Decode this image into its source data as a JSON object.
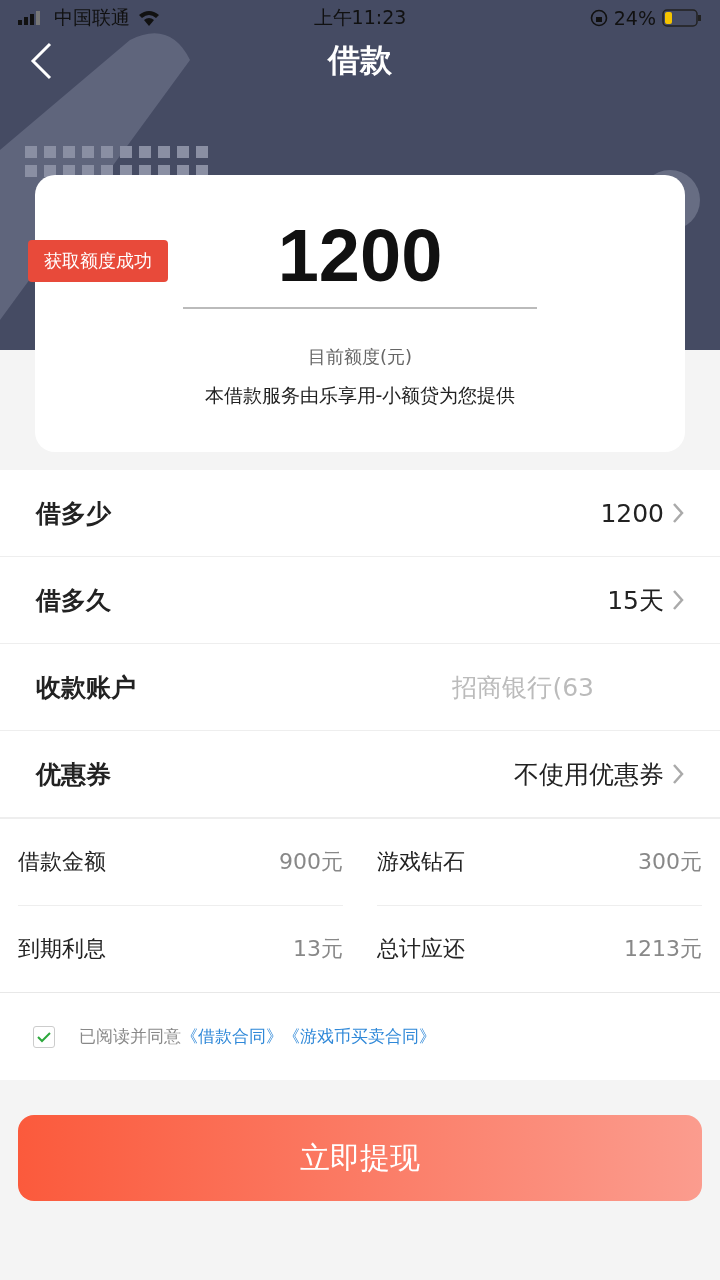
{
  "status_bar": {
    "carrier": "中国联通",
    "time": "上午11:23",
    "battery": "24%"
  },
  "header": {
    "title": "借款"
  },
  "credit_card": {
    "badge": "获取额度成功",
    "amount": "1200",
    "amount_label": "目前额度(元)",
    "provider_note": "本借款服务由乐享用-小额贷为您提供"
  },
  "options": [
    {
      "label": "借多少",
      "value": "1200",
      "kind": "arrow"
    },
    {
      "label": "借多久",
      "value": "15天",
      "kind": "arrow"
    },
    {
      "label": "收款账户",
      "value": "招商银行(63",
      "kind": "faded"
    },
    {
      "label": "优惠券",
      "value": "不使用优惠券",
      "kind": "arrow"
    }
  ],
  "summary": [
    {
      "label": "借款金额",
      "value": "900元"
    },
    {
      "label": "游戏钻石",
      "value": "300元"
    },
    {
      "label": "到期利息",
      "value": "13元"
    },
    {
      "label": "总计应还",
      "value": "1213元"
    }
  ],
  "agreement": {
    "checked": true,
    "text": "已阅读并同意",
    "links": [
      "《借款合同》",
      "《游戏币买卖合同》"
    ]
  },
  "submit_button": "立即提现"
}
